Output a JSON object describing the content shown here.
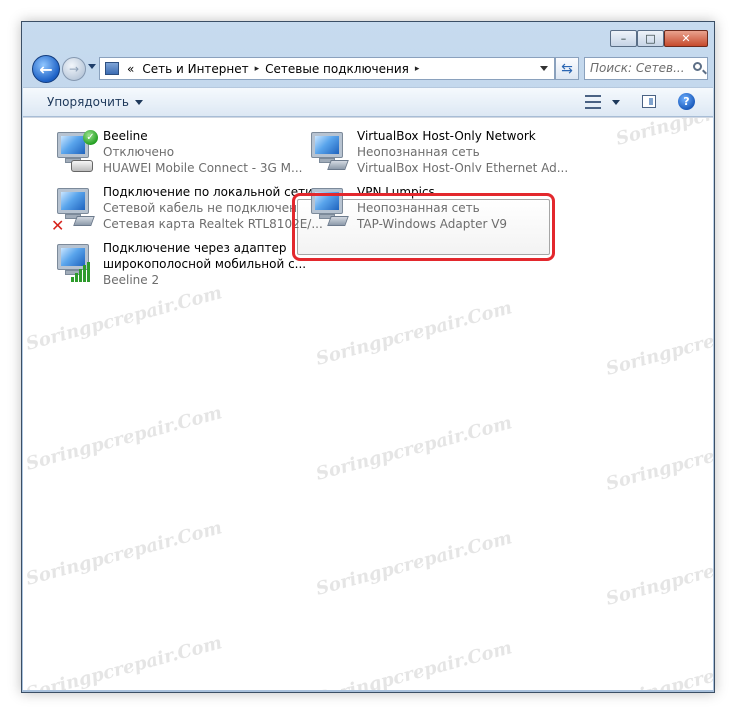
{
  "window": {
    "buttons": {
      "minimize": "–",
      "maximize": "□",
      "close": "✕"
    }
  },
  "address_bar": {
    "prefix": "«",
    "crumbs": [
      "Сеть и Интернет",
      "Сетевые подключения"
    ],
    "separator": "▸"
  },
  "search": {
    "placeholder": "Поиск: Сетев..."
  },
  "toolbar": {
    "organize_label": "Упорядочить",
    "help_label": "?"
  },
  "connections": [
    {
      "name": "Beeline",
      "status": "Отключено",
      "adapter": "HUAWEI Mobile Connect - 3G M..."
    },
    {
      "name": "VirtualBox Host-Only Network",
      "status": "Неопознанная сеть",
      "adapter": "VirtualBox Host-Only Ethernet Ad..."
    },
    {
      "name": "Подключение по локальной сети",
      "status": "Сетевой кабель не подключен",
      "adapter": "Сетевая карта Realtek RTL8102E/..."
    },
    {
      "name": "VPN Lumpics",
      "status": "Неопознанная сеть",
      "adapter": "TAP-Windows Adapter V9"
    },
    {
      "name": "Подключение через адаптер",
      "status": "широкополосной мобильной с...",
      "adapter": "Beeline  2"
    }
  ],
  "watermark": "Soringpcrepair.Com",
  "colors": {
    "highlight": "#e3282d",
    "subtext": "#6d6d6d",
    "accent": "#1f63be"
  }
}
